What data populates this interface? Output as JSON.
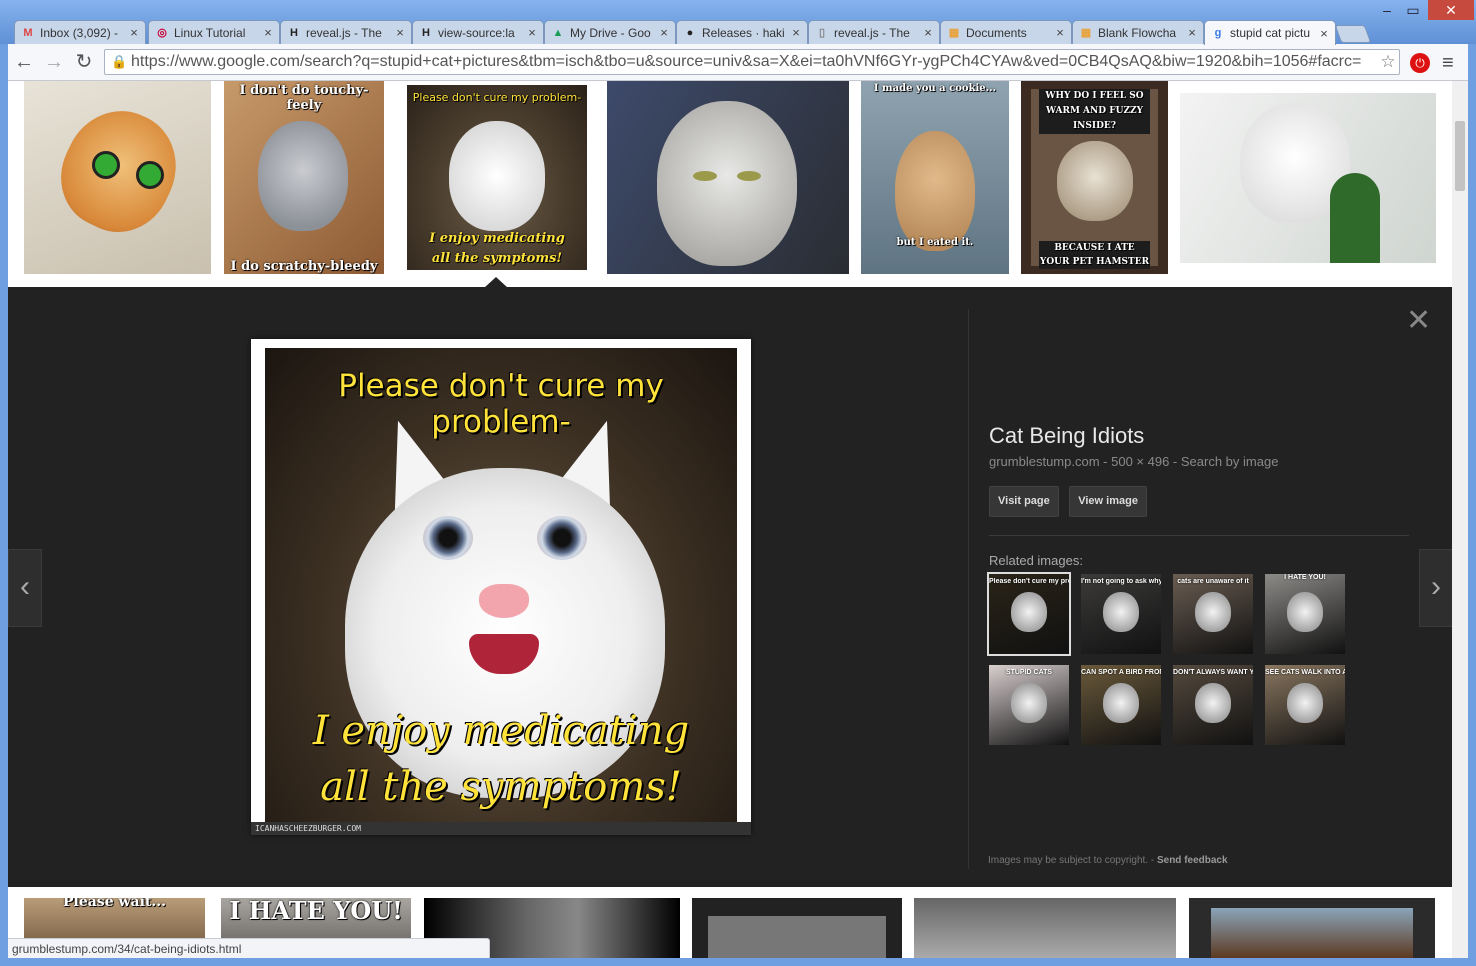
{
  "tabs": [
    {
      "label": "Inbox (3,092) -",
      "icon": "gmail-icon",
      "glyph": "M",
      "color": "#d44"
    },
    {
      "label": "Linux Tutorial",
      "icon": "debian-icon",
      "glyph": "◎",
      "color": "#c03"
    },
    {
      "label": "reveal.js - The",
      "icon": "h-logo-icon",
      "glyph": "H",
      "color": "#222"
    },
    {
      "label": "view-source:la",
      "icon": "h-logo-icon",
      "glyph": "H",
      "color": "#222"
    },
    {
      "label": "My Drive - Goo",
      "icon": "drive-icon",
      "glyph": "▲",
      "color": "#1a9e55"
    },
    {
      "label": "Releases · haki",
      "icon": "github-icon",
      "glyph": "●",
      "color": "#222"
    },
    {
      "label": "reveal.js - The",
      "icon": "page-icon",
      "glyph": "▯",
      "color": "#888"
    },
    {
      "label": "Documents",
      "icon": "folder-icon",
      "glyph": "▦",
      "color": "#e8a23a"
    },
    {
      "label": "Blank Flowcha",
      "icon": "flowchart-icon",
      "glyph": "▦",
      "color": "#e8a23a"
    },
    {
      "label": "stupid cat pictu",
      "icon": "google-icon",
      "glyph": "g",
      "color": "#3b7be8"
    }
  ],
  "toolbar": {
    "url": "https://www.google.com/search?q=stupid+cat+pictures&tbm=isch&tbo=u&source=univ&sa=X&ei=ta0hVNf6GYr-ygPCh4CYAw&ved=0CB4QsAQ&biw=1920&bih=1056#facrc="
  },
  "top_thumbs": [
    {
      "caption_top": "",
      "caption_bottom": ""
    },
    {
      "caption_top": "I don't do touchy-feely",
      "caption_bottom": "I do scratchy-bleedy"
    },
    {
      "caption_top": "Please don't cure my problem-",
      "caption_bottom": "I enjoy medicating all the symptoms!"
    },
    {
      "caption_top": "",
      "caption_bottom": ""
    },
    {
      "caption_top": "I made you a cookie...",
      "caption_bottom": "but I eated it."
    },
    {
      "caption_top": "WHY DO I FEEL SO WARM AND FUZZY INSIDE?",
      "caption_bottom": "BECAUSE I ATE YOUR PET HAMSTER"
    },
    {
      "caption_top": "",
      "caption_bottom": ""
    }
  ],
  "preview": {
    "caption_top": "Please don't cure my problem-",
    "caption_line1": "I enjoy medicating",
    "caption_line2": "all the symptoms!",
    "watermark": "ICANHASCHEEZBURGER.COM"
  },
  "details": {
    "title": "Cat Being Idiots",
    "domain": "grumblestump.com",
    "sep1": " - ",
    "dimensions": "500 × 496",
    "sep2": " - ",
    "search_by_image": "Search by image",
    "visit_page": "Visit page",
    "view_image": "View image",
    "related_label": "Related images:",
    "copyright": "Images may be subject to copyright.",
    "sep3": " - ",
    "feedback": "Send feedback"
  },
  "related": [
    {
      "caption": "Please don't cure my problem",
      "bg": "#2a2418"
    },
    {
      "caption": "I'm not going to ask why",
      "bg": "#3c3b3a"
    },
    {
      "caption": "cats are unaware of it",
      "bg": "#6a5d52"
    },
    {
      "caption": "I HATE YOU!",
      "bg": "#8d8b88"
    },
    {
      "caption": "STUPID CATS",
      "bg": "#d9cfcf"
    },
    {
      "caption": "CAN SPOT A BIRD FROM ACROSS THE YARD",
      "bg": "#6b5a3b"
    },
    {
      "caption": "DON'T ALWAYS WANT YOU TO OPEN THE DOOR FOR ME",
      "bg": "#554a3e"
    },
    {
      "caption": "SEE CATS WALK INTO A BAR",
      "bg": "#8a7760"
    }
  ],
  "bottom_thumbs": [
    {
      "caption": "Please wait..."
    },
    {
      "caption": "I HATE YOU!"
    },
    {
      "caption": ""
    },
    {
      "caption": ""
    },
    {
      "caption": ""
    },
    {
      "caption": ""
    }
  ],
  "status": {
    "url": "grumblestump.com/34/cat-being-idiots.html"
  }
}
